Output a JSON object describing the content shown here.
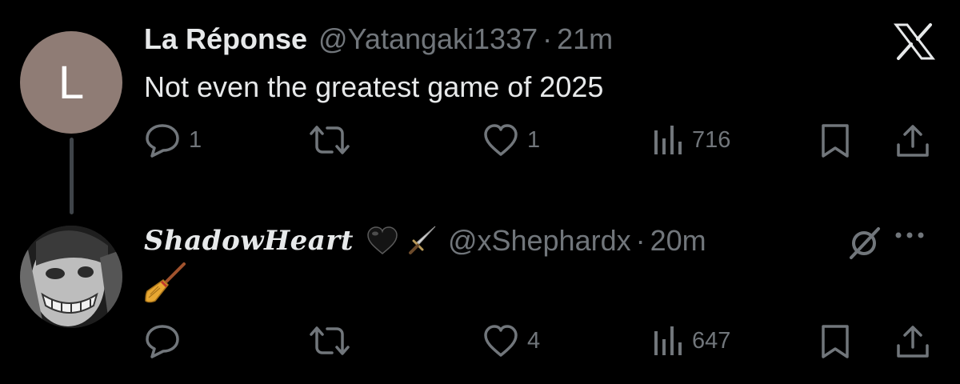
{
  "colors": {
    "background": "#000000",
    "text": "#e7e9ea",
    "muted": "#71767b",
    "avatar_bg": "#8f7c75",
    "thread_line": "#3f4449"
  },
  "tweets": [
    {
      "avatar_letter": "L",
      "display_name": "La Réponse",
      "handle": "@Yatangaki1337",
      "separator": "·",
      "time": "21m",
      "text": "Not even the greatest game of 2025",
      "actions": {
        "reply_count": "1",
        "repost_count": "",
        "like_count": "1",
        "views_count": "716"
      },
      "corner_icon": "x-logo-icon"
    },
    {
      "display_name": "ShadowHeart",
      "name_emojis": [
        "black-heart-emoji",
        "dagger-emoji"
      ],
      "handle": "@xShephardx",
      "separator": "·",
      "time": "20m",
      "content_emoji": "broom-emoji",
      "actions": {
        "reply_count": "",
        "repost_count": "",
        "like_count": "4",
        "views_count": "647"
      },
      "corner_icons": [
        "grok-icon",
        "more-icon"
      ]
    }
  ]
}
